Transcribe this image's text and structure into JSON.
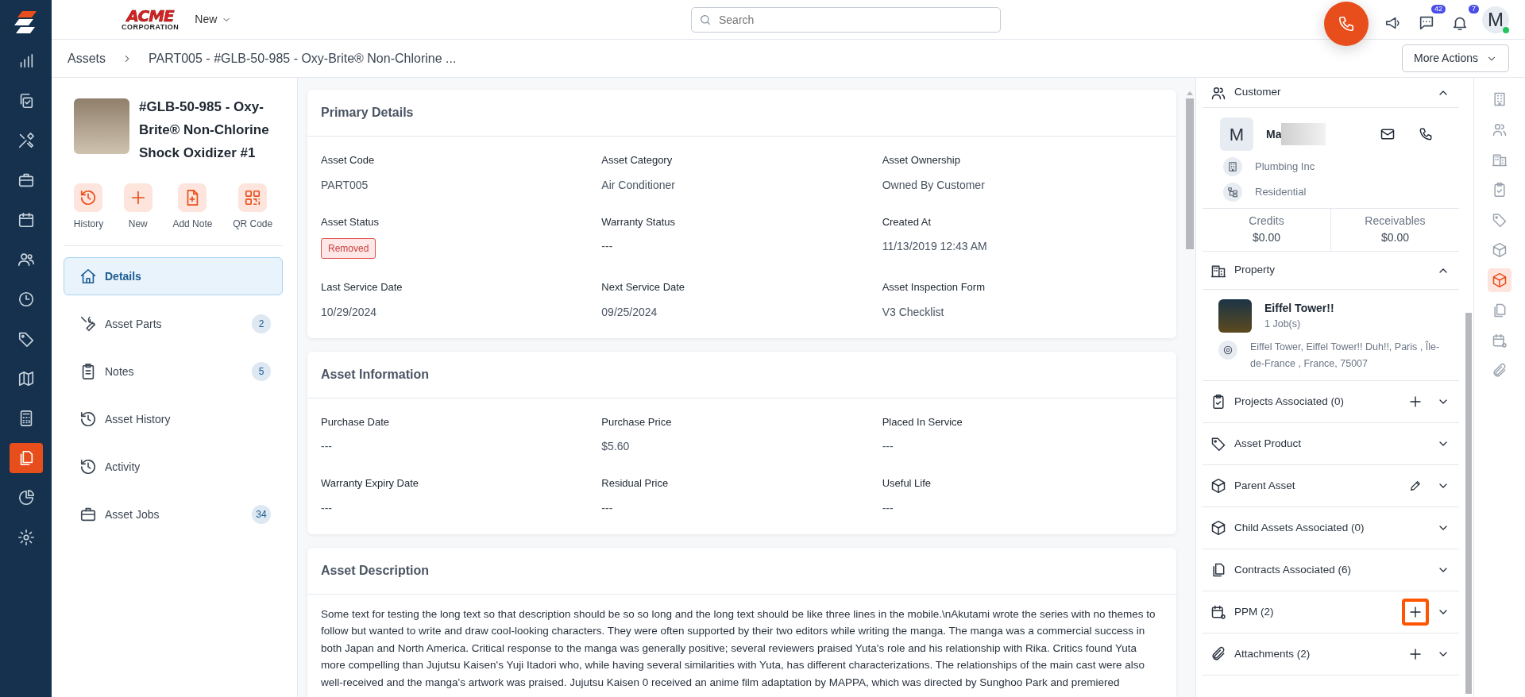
{
  "app_nav": [
    {
      "selected": false
    },
    {
      "selected": false
    },
    {
      "selected": false
    },
    {
      "selected": false
    },
    {
      "selected": false
    },
    {
      "selected": false
    },
    {
      "selected": false
    },
    {
      "selected": false
    },
    {
      "selected": false
    },
    {
      "selected": false
    },
    {
      "selected": true
    },
    {
      "selected": false
    },
    {
      "selected": false
    }
  ],
  "top_bar": {
    "logo": {
      "name": "ACME",
      "sub": "CORPORATION"
    },
    "new_menu": "New",
    "search": {
      "placeholder": "Search"
    },
    "chat_badge": "42",
    "bell_badge": "7",
    "avatar": {
      "initial": "M",
      "online": true
    }
  },
  "breadcrumb": [
    "Assets",
    "PART005 - #GLB-50-985 - Oxy-Brite® Non-Chlorine ..."
  ],
  "more_actions": "More Actions",
  "asset": {
    "title": "#GLB-50-985 - Oxy-Brite® Non-Chlorine Shock Oxidizer #1",
    "quick_actions": [
      "History",
      "New",
      "Add Note",
      "QR Code"
    ],
    "tabs": [
      {
        "label": "Details",
        "selected": true
      },
      {
        "label": "Asset Parts",
        "count": "2",
        "selected": false
      },
      {
        "label": "Notes",
        "count": "5",
        "selected": false
      },
      {
        "label": "Asset History",
        "selected": false
      },
      {
        "label": "Activity",
        "selected": false
      },
      {
        "label": "Asset Jobs",
        "count": "34",
        "selected": false
      }
    ]
  },
  "cards": [
    {
      "title": "Primary Details",
      "fields": [
        {
          "label": "Asset Code",
          "value": "PART005",
          "kind": "text"
        },
        {
          "label": "Asset Category",
          "value": "Air Conditioner",
          "kind": "text"
        },
        {
          "label": "Asset Ownership",
          "value": "Owned By Customer",
          "kind": "text"
        },
        {
          "label": "Asset Status",
          "value": "Removed",
          "kind": "badge"
        },
        {
          "label": "Warranty Status",
          "value": "---",
          "kind": "text"
        },
        {
          "label": "Created At",
          "value": "11/13/2019 12:43 AM",
          "kind": "text"
        },
        {
          "label": "Last Service Date",
          "value": "10/29/2024",
          "kind": "text"
        },
        {
          "label": "Next Service Date",
          "value": "09/25/2024",
          "kind": "text"
        },
        {
          "label": "Asset Inspection Form",
          "value": "V3 Checklist",
          "kind": "text"
        }
      ]
    },
    {
      "title": "Asset Information",
      "fields": [
        {
          "label": "Purchase Date",
          "value": "---",
          "kind": "text"
        },
        {
          "label": "Purchase Price",
          "value": "$5.60",
          "kind": "text"
        },
        {
          "label": "Placed In Service",
          "value": "---",
          "kind": "text"
        },
        {
          "label": "Warranty Expiry Date",
          "value": "---",
          "kind": "text"
        },
        {
          "label": "Residual Price",
          "value": "---",
          "kind": "text"
        },
        {
          "label": "Useful Life",
          "value": "---",
          "kind": "text"
        }
      ]
    },
    {
      "title": "Asset Description",
      "text": "Some text for testing the long text so that description should be so so long and the long text should be like three lines in the mobile.\\nAkutami wrote the series with no themes to follow but wanted to write and draw cool-looking characters. They were often supported by their two editors while writing the manga. The manga was a commercial success in both Japan and North America. Critical response to the manga was generally positive; several reviewers praised Yuta's role and his relationship with Rika. Critics found Yuta more compelling than Jujutsu Kaisen's Yuji Itadori who, while having several similarities with Yuta, has different characterizations. The relationships of the main cast were also well-received and the manga's artwork was praised. Jujutsu Kaisen 0 received an anime film adaptation by MAPPA, which was directed by Sunghoo Park and premiered"
    }
  ],
  "customer": {
    "title": "Customer",
    "expanded": true,
    "initial": "M",
    "name": "Ma",
    "company": "Plumbing Inc",
    "type": "Residential",
    "credits": {
      "label": "Credits",
      "value": "$0.00"
    },
    "receivables": {
      "label": "Receivables",
      "value": "$0.00"
    }
  },
  "property": {
    "title": "Property",
    "expanded": true,
    "name": "Eiffel Tower!!",
    "jobs": "1 Job(s)",
    "address": "Eiffel Tower, Eiffel Tower!! Duh!!, Paris , Île-de-France , France, 75007"
  },
  "sections": [
    {
      "title": "Projects Associated (0)",
      "actions": [
        {
          "kind": "add",
          "highlighted": false
        }
      ],
      "expanded": false
    },
    {
      "title": "Asset Product",
      "expanded": false
    },
    {
      "title": "Parent Asset",
      "actions": [
        {
          "kind": "edit",
          "highlighted": false
        }
      ],
      "expanded": false
    },
    {
      "title": "Child Assets Associated (0)",
      "expanded": false
    },
    {
      "title": "Contracts Associated (6)",
      "expanded": false
    },
    {
      "title": "PPM (2)",
      "actions": [
        {
          "kind": "add",
          "highlighted": true
        }
      ],
      "expanded": false
    },
    {
      "title": "Attachments (2)",
      "actions": [
        {
          "kind": "add",
          "highlighted": false
        }
      ],
      "expanded": false
    }
  ],
  "right_rail": [
    {
      "selected": false
    },
    {
      "selected": false
    },
    {
      "selected": false
    },
    {
      "selected": false
    },
    {
      "selected": false
    },
    {
      "selected": false
    },
    {
      "selected": true
    },
    {
      "selected": false
    },
    {
      "selected": false
    },
    {
      "selected": false
    }
  ]
}
